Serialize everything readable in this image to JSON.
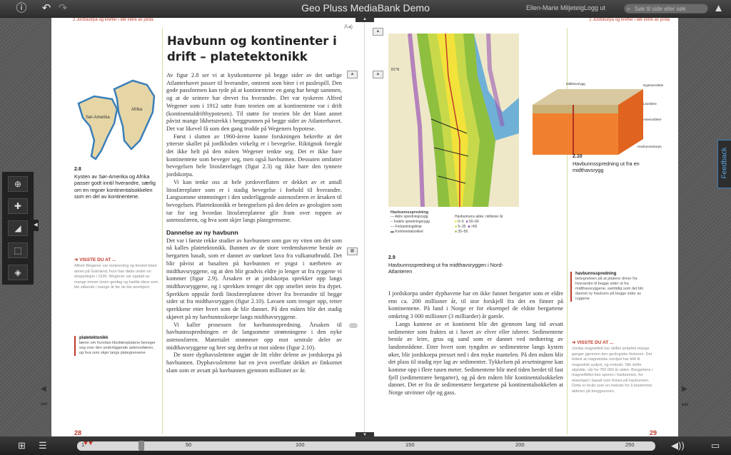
{
  "app": {
    "title": "Geo Pluss MediaBank Demo",
    "user": "Ellen-Marie Miljeteig",
    "logout": "Logg ut",
    "search_placeholder": "Søk til side eller søk",
    "feedback": "Feedback"
  },
  "page_left": {
    "header": "2 Jordskorpa og krefter i det indre av jorda",
    "number": "28",
    "title": "Havbunn og kontinenter i drift – platetektonikk",
    "map_labels": {
      "south_america": "Sør-Amerika",
      "africa": "Afrika"
    },
    "figure_num": "2.8",
    "figure_caption": "Kysten av Sør-Amerika og Afrika passer godt inntil hverandre, særlig om en regner kontinentalsokkelen som en del av kontinentene.",
    "paragraphs": [
      "Av figur 2.8 ser vi at kystkonturene på begge sider av det sørlige Atlanterhavet passer til hverandre, omtrent som biter i et puslespill. Den gode passformen kan tyde på at kontinentene en gang har hengt sammen, og at de seinere har drevet fra hverandre. Det var tyskeren Alfred Wegener som i 1912 satte fram teorien om at kontinentene var i drift (kontinentaldrifthypotesen). Til støtte for teorien ble det blant annet påvist mange likhetstrekk i berggrunnen på begge sider av Atlanterhavet. Det var likevel få som den gang trodde på Wegeners hypotese.",
      "Først i slutten av 1960-årene kunne forskningen bekrefte at det ytterste skallet på jordkloden virkelig er i bevegelse. Riktignok foregår det ikke helt på den måten Wegener tenkte seg. Det er ikke bare kontinentene som beveger seg, men også havbunnen. Dessuten omfatter bevegelsen hele litosfærelaget (figur 2.3) og ikke bare den tynnere jordskorpa.",
      "Vi kan tenke oss at hele jordoverflaten er dekket av et antall litosfæreplater som er i stadig bevegelse i forhold til hverandre. Langsomme strømninger i den underliggende astenosfæren er årsaken til bevegelsen. Platetektonikk er betegnelsen på den delen av geologien som tar for seg hvordan litosfæreplatene glir fram over toppen av astenosfæren, og hva som skjer langs plategrensene."
    ],
    "subheading": "Dannelse av ny havbunn",
    "paragraphs2": [
      "Det var i første rekke studier av havbunnen som gav ny viten om det som nå kalles platetektonikk. Bunnen av de store verdenshavene består av bergarten basalt, som er dannet av størknet lava fra vulkanutbrudd. Det blir påvist at basalten på havbunnen er yngst i nærheten av midthavsryggene, og at den blir gradvis eldre jo lenger ut fra ryggene vi kommer (figur 2.9). Årsaken er at jordskorpa sprekker opp langs midthavsryggene, og i sprekken trenger det opp smeltet stein fra dypet. Sprekken oppstår fordi litosfæreplatene driver fra hverandre til begge sider ut fra midthavsryggen (figur 2.10). Lavaen som trenger opp, tetter sprekkene etter hvert som de blir dannet. På den måten blir det stadig skjøvet på ny havbunnsskorpe langs midthavsryggene.",
      "Vi kaller prosessen for havbunnsspredning. Årsaken til havbunnsspredningen er de langsomme strømningene i den nyke astenosfæren. Materialet strømmer opp mot sentrale deler av midthavsryggene og brer seg derfra ut mot sidene (figur 2.10).",
      "De store dyphavsslettene utgjør de litt eldre delene av jordskorpa på havbunnen. Dyphavsslettene har en jevn overflate dekket av finkornet slam som er avsatt på havbunnen gjennom millioner av år."
    ],
    "did_you_know_title": "➜ VISSTE DU AT ...",
    "did_you_know_text": "Alfred Wegener var meteorolog og forsket blant annet på Grønland, hvor han døde under en ekspedisjon i 1930. Wegener var opptatt av mange emner innen geofag og hadde ideer som ble stående i mange år før de ble anerkjent.",
    "glossary_term": "platetektonikk",
    "glossary_text": "læren om hvordan litosfæreplatene beveger seg over den underliggende astenosfæren, og hva som skjer langs plategrensene"
  },
  "page_right": {
    "header": "2 Jordskorpa og krefter i det indre av jorda",
    "number": "29",
    "figure9_num": "2.9",
    "figure9_caption": "Havbunnsspredning ut fra midthavsryggen i Nord-Atlanteren",
    "legend_title": "Havbunnsspredning",
    "legend_items": [
      "Aktiv spredningsrygg",
      "Inaktiv spredningsrygg",
      "Forkastningslinje",
      "Kontinentalsokkel"
    ],
    "age_title": "Havbunnens alder, millioner år",
    "age_items": [
      "0–5",
      "5–35",
      "35–50",
      "50–66",
      ">66"
    ],
    "lat_label": "81°N",
    "figure10_num": "2.10",
    "figure10_caption": "Havbunnsspredning ut fra en midthavsrygg",
    "diagram_labels": [
      "Midthavsrygg",
      "Dyphavsslette",
      "Litosfære",
      "Astenosfære",
      "Havbunnsskorpe"
    ],
    "paragraphs": [
      "I jordskorpa under dyphavene har en ikke funnet bergarter som er eldre enn ca. 200 millioner år, til stor forskjell fra det en finner på kontinentene. På land i Norge er for eksempel de eldste bergartene omkring 3 000 millioner (3 milliarder) år gamle.",
      "Langs kantene av et kontinent blir det gjennom lang tid avsatt sedimenter som fraktes ut i havet av elver eller isbreer. Sedimentene består av leire, grus og sand som er dannet ved nedtæring av landområdene. Etter hvert som tyngden av sedimentene langs kysten øker, blir jordskorpa presset ned i den myke mantelen. På den måten blir det plass til stadig nye lag av sedimenter. Tykkelsen på avsetningene kan komme opp i flere tusen meter. Sedimentene blir med tiden herdet til fast fjell (sedimentære bergarter), og på den måten blir kontinentalsokkelen dannet. Det er fra de sedimentære bergartene på kontinentalsokkelen at Norge utvinner olje og gass."
    ],
    "glossary_term": "havbunnsspredning",
    "glossary_text": "betegnelsen på at platene driver fra hverandre til begge sider ut fra midthavsryggene, samtidig som det blir dannet ny havbunn på begge sider av ryggene",
    "did_you_know_title": "➜ VISSTE DU AT ...",
    "did_you_know_text": "Jordas magnetfelt har skiftet polaritet mange ganger gjennom den geologiske historien. Det lettest at magnetiske nordpol har blitt til magnetisk sydpol, og motsatt. Slik skifte skjedde, vår for 750 000 år siden. Bergartene i magnetfeltet kan spores i havbunnen, for eksempel i basalt som finnes på havbunnen. Dette er brukt som en metode for å bestemme alderen på berggrunnen."
  },
  "timeline": {
    "ticks": [
      "1",
      "50",
      "100",
      "150",
      "200",
      "250"
    ]
  },
  "colors": {
    "accent": "#c0392b",
    "topbar": "#3a3a3a",
    "divider": "#cfe0a4"
  }
}
